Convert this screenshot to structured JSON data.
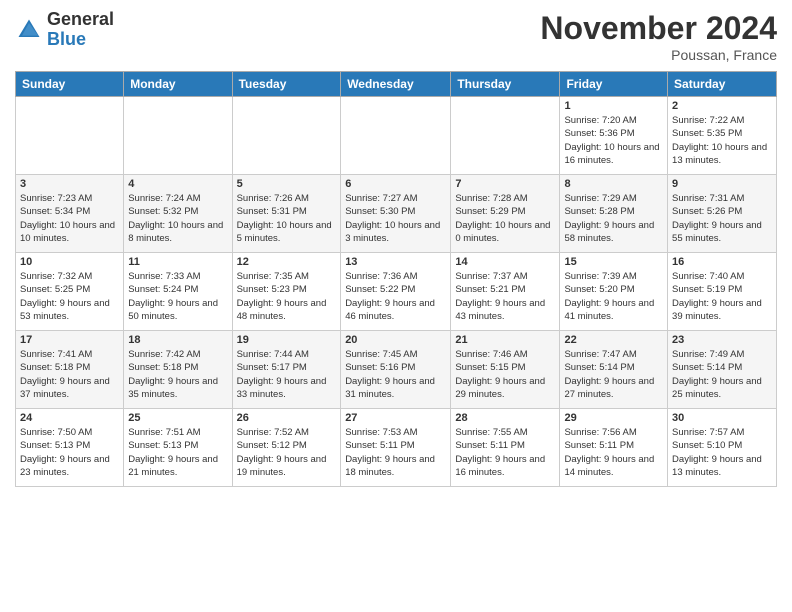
{
  "logo": {
    "line1": "General",
    "line2": "Blue"
  },
  "header": {
    "month": "November 2024",
    "location": "Poussan, France"
  },
  "weekdays": [
    "Sunday",
    "Monday",
    "Tuesday",
    "Wednesday",
    "Thursday",
    "Friday",
    "Saturday"
  ],
  "weeks": [
    [
      {
        "day": "",
        "info": ""
      },
      {
        "day": "",
        "info": ""
      },
      {
        "day": "",
        "info": ""
      },
      {
        "day": "",
        "info": ""
      },
      {
        "day": "",
        "info": ""
      },
      {
        "day": "1",
        "info": "Sunrise: 7:20 AM\nSunset: 5:36 PM\nDaylight: 10 hours and 16 minutes."
      },
      {
        "day": "2",
        "info": "Sunrise: 7:22 AM\nSunset: 5:35 PM\nDaylight: 10 hours and 13 minutes."
      }
    ],
    [
      {
        "day": "3",
        "info": "Sunrise: 7:23 AM\nSunset: 5:34 PM\nDaylight: 10 hours and 10 minutes."
      },
      {
        "day": "4",
        "info": "Sunrise: 7:24 AM\nSunset: 5:32 PM\nDaylight: 10 hours and 8 minutes."
      },
      {
        "day": "5",
        "info": "Sunrise: 7:26 AM\nSunset: 5:31 PM\nDaylight: 10 hours and 5 minutes."
      },
      {
        "day": "6",
        "info": "Sunrise: 7:27 AM\nSunset: 5:30 PM\nDaylight: 10 hours and 3 minutes."
      },
      {
        "day": "7",
        "info": "Sunrise: 7:28 AM\nSunset: 5:29 PM\nDaylight: 10 hours and 0 minutes."
      },
      {
        "day": "8",
        "info": "Sunrise: 7:29 AM\nSunset: 5:28 PM\nDaylight: 9 hours and 58 minutes."
      },
      {
        "day": "9",
        "info": "Sunrise: 7:31 AM\nSunset: 5:26 PM\nDaylight: 9 hours and 55 minutes."
      }
    ],
    [
      {
        "day": "10",
        "info": "Sunrise: 7:32 AM\nSunset: 5:25 PM\nDaylight: 9 hours and 53 minutes."
      },
      {
        "day": "11",
        "info": "Sunrise: 7:33 AM\nSunset: 5:24 PM\nDaylight: 9 hours and 50 minutes."
      },
      {
        "day": "12",
        "info": "Sunrise: 7:35 AM\nSunset: 5:23 PM\nDaylight: 9 hours and 48 minutes."
      },
      {
        "day": "13",
        "info": "Sunrise: 7:36 AM\nSunset: 5:22 PM\nDaylight: 9 hours and 46 minutes."
      },
      {
        "day": "14",
        "info": "Sunrise: 7:37 AM\nSunset: 5:21 PM\nDaylight: 9 hours and 43 minutes."
      },
      {
        "day": "15",
        "info": "Sunrise: 7:39 AM\nSunset: 5:20 PM\nDaylight: 9 hours and 41 minutes."
      },
      {
        "day": "16",
        "info": "Sunrise: 7:40 AM\nSunset: 5:19 PM\nDaylight: 9 hours and 39 minutes."
      }
    ],
    [
      {
        "day": "17",
        "info": "Sunrise: 7:41 AM\nSunset: 5:18 PM\nDaylight: 9 hours and 37 minutes."
      },
      {
        "day": "18",
        "info": "Sunrise: 7:42 AM\nSunset: 5:18 PM\nDaylight: 9 hours and 35 minutes."
      },
      {
        "day": "19",
        "info": "Sunrise: 7:44 AM\nSunset: 5:17 PM\nDaylight: 9 hours and 33 minutes."
      },
      {
        "day": "20",
        "info": "Sunrise: 7:45 AM\nSunset: 5:16 PM\nDaylight: 9 hours and 31 minutes."
      },
      {
        "day": "21",
        "info": "Sunrise: 7:46 AM\nSunset: 5:15 PM\nDaylight: 9 hours and 29 minutes."
      },
      {
        "day": "22",
        "info": "Sunrise: 7:47 AM\nSunset: 5:14 PM\nDaylight: 9 hours and 27 minutes."
      },
      {
        "day": "23",
        "info": "Sunrise: 7:49 AM\nSunset: 5:14 PM\nDaylight: 9 hours and 25 minutes."
      }
    ],
    [
      {
        "day": "24",
        "info": "Sunrise: 7:50 AM\nSunset: 5:13 PM\nDaylight: 9 hours and 23 minutes."
      },
      {
        "day": "25",
        "info": "Sunrise: 7:51 AM\nSunset: 5:13 PM\nDaylight: 9 hours and 21 minutes."
      },
      {
        "day": "26",
        "info": "Sunrise: 7:52 AM\nSunset: 5:12 PM\nDaylight: 9 hours and 19 minutes."
      },
      {
        "day": "27",
        "info": "Sunrise: 7:53 AM\nSunset: 5:11 PM\nDaylight: 9 hours and 18 minutes."
      },
      {
        "day": "28",
        "info": "Sunrise: 7:55 AM\nSunset: 5:11 PM\nDaylight: 9 hours and 16 minutes."
      },
      {
        "day": "29",
        "info": "Sunrise: 7:56 AM\nSunset: 5:11 PM\nDaylight: 9 hours and 14 minutes."
      },
      {
        "day": "30",
        "info": "Sunrise: 7:57 AM\nSunset: 5:10 PM\nDaylight: 9 hours and 13 minutes."
      }
    ]
  ]
}
